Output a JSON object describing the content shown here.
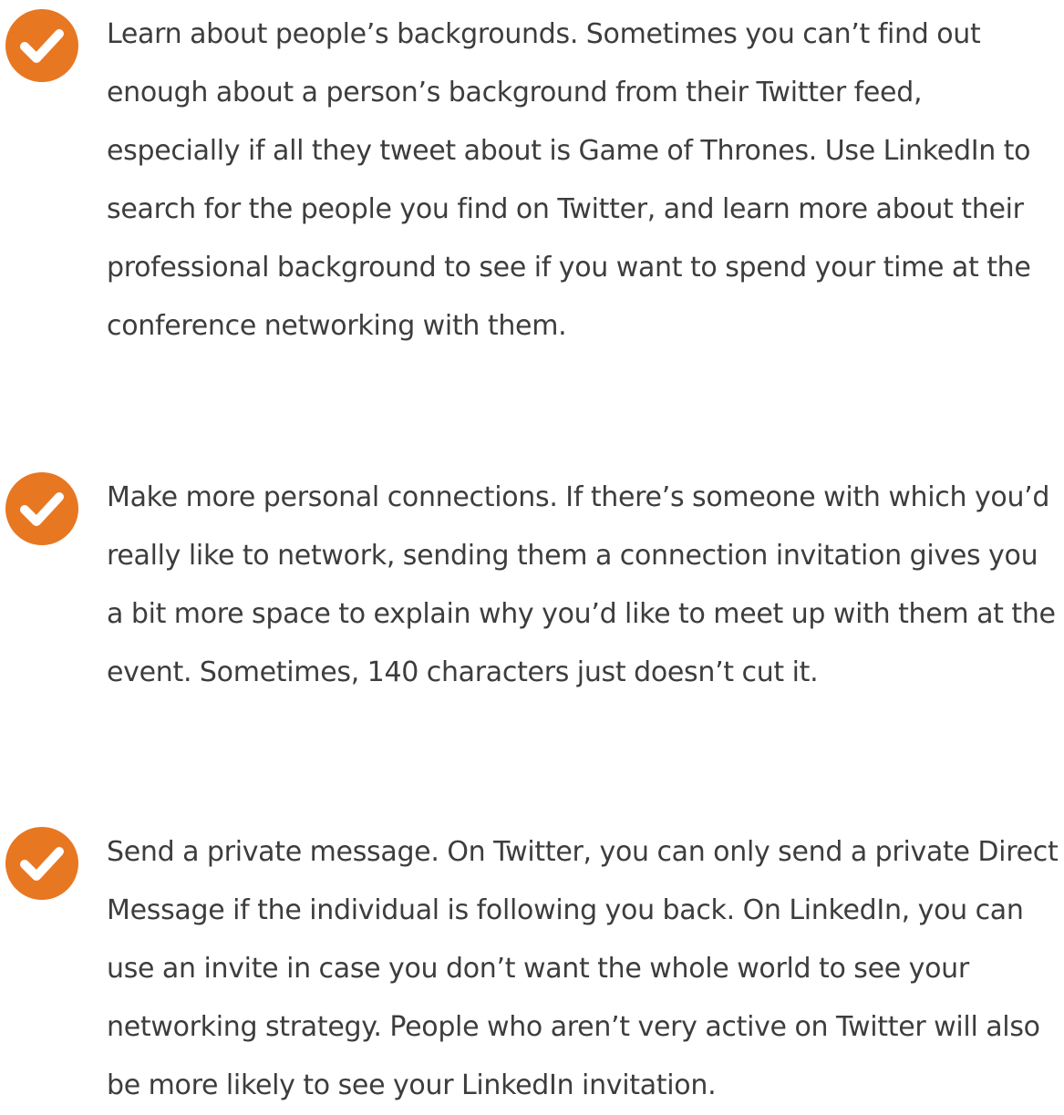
{
  "colors": {
    "accent": "#E87722",
    "text": "#3d3d3d",
    "background": "#ffffff"
  },
  "tips": [
    {
      "icon": "check-circle-icon",
      "text": "Learn about people’s backgrounds. Sometimes you can’t find out enough about a person’s background from their Twitter feed, especially if all they tweet about is Game of Thrones. Use LinkedIn to search for the people you find on Twitter, and learn more about their professional background to see if you want to spend your time at the conference networking with them."
    },
    {
      "icon": "check-circle-icon",
      "text": "Make more personal connections. If there’s someone with which you’d really like to network, sending them a connection invitation gives you a bit more space to explain why you’d like to meet up with them at the event. Sometimes, 140 characters just doesn’t cut it."
    },
    {
      "icon": "check-circle-icon",
      "text": "Send a private message. On Twitter, you can only send a private Direct Message if the individual is following you back. On LinkedIn, you can use an invite in case you don’t want the whole world to see your networking strategy. People who aren’t very active on Twitter will also be more likely to see your LinkedIn invitation."
    }
  ]
}
